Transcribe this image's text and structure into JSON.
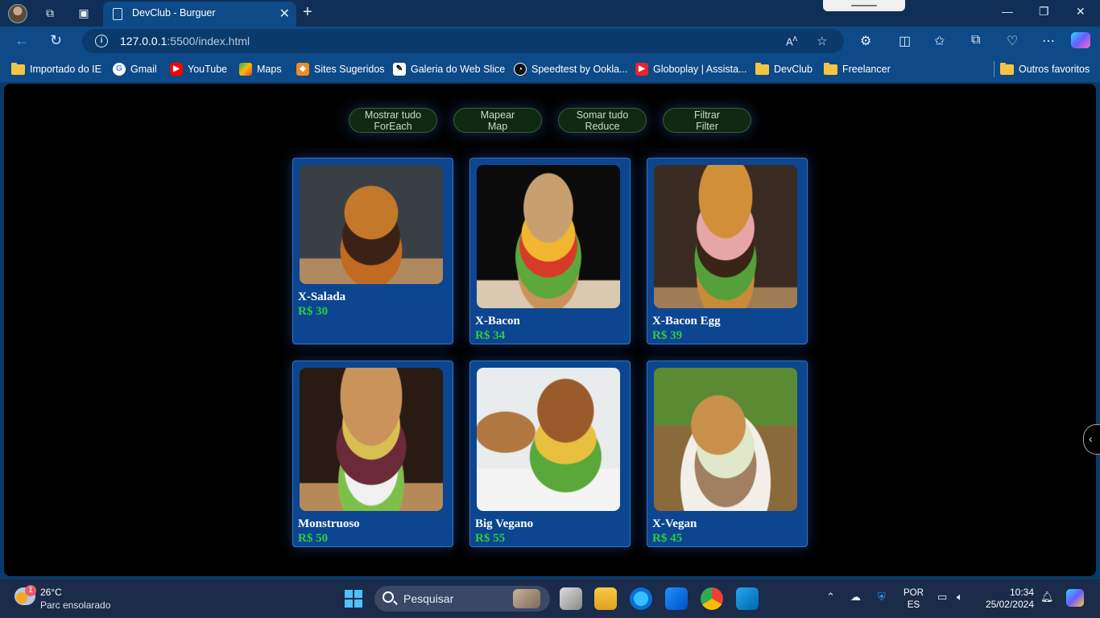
{
  "browser": {
    "tab_title": "DevClub - Burguer",
    "url_host": "127.0.0.1",
    "url_path": ":5500/index.html",
    "new_tab": "+"
  },
  "favorites": [
    {
      "label": "Importado do IE",
      "icon": "folder-icon"
    },
    {
      "label": "Gmail",
      "icon": "google-icon"
    },
    {
      "label": "YouTube",
      "icon": "youtube-icon"
    },
    {
      "label": "Maps",
      "icon": "maps-icon"
    },
    {
      "label": "Sites Sugeridos",
      "icon": "sites-icon"
    },
    {
      "label": "Galeria do Web Slice",
      "icon": "webslice-icon"
    },
    {
      "label": "Speedtest by Ookla...",
      "icon": "speedtest-icon"
    },
    {
      "label": "Globoplay | Assista...",
      "icon": "globoplay-icon"
    },
    {
      "label": "DevClub",
      "icon": "folder-icon"
    },
    {
      "label": "Freelancer",
      "icon": "folder-icon"
    }
  ],
  "other_favorites": "Outros favoritos",
  "page": {
    "buttons": [
      {
        "line1": "Mostrar tudo",
        "line2": "ForEach"
      },
      {
        "line1": "Mapear",
        "line2": "Map"
      },
      {
        "line1": "Somar tudo",
        "line2": "Reduce"
      },
      {
        "line1": "Filtrar",
        "line2": "Filter"
      }
    ],
    "products": [
      {
        "name": "X-Salada",
        "price": "R$ 30"
      },
      {
        "name": "X-Bacon",
        "price": "R$ 34"
      },
      {
        "name": "X-Bacon Egg",
        "price": "R$ 39"
      },
      {
        "name": "Monstruoso",
        "price": "R$ 50"
      },
      {
        "name": "Big Vegano",
        "price": "R$ 55"
      },
      {
        "name": "X-Vegan",
        "price": "R$ 45"
      }
    ]
  },
  "taskbar": {
    "weather_badge": "1",
    "temperature": "26°C",
    "condition": "Parc ensolarado",
    "search_placeholder": "Pesquisar",
    "lang1": "POR",
    "lang2": "ES",
    "time": "10:34",
    "date": "25/02/2024"
  }
}
